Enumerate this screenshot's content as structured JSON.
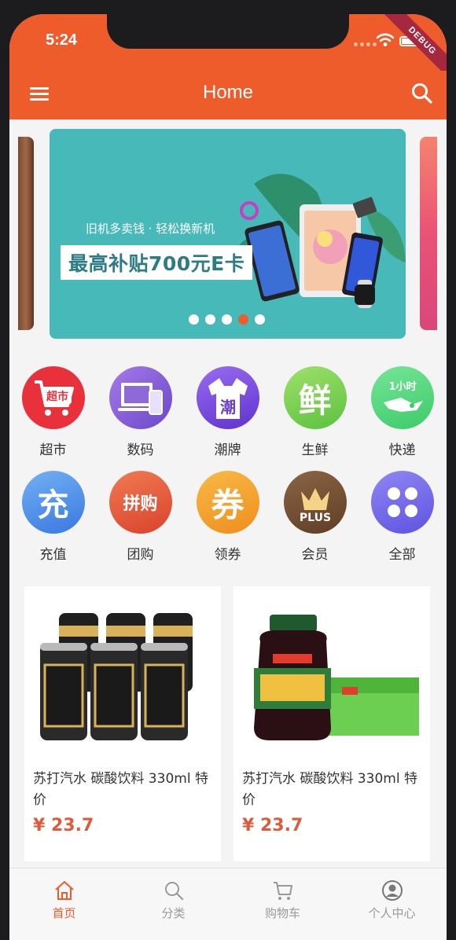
{
  "status_bar": {
    "time": "5:24",
    "debug_label": "DEBUG"
  },
  "app_bar": {
    "title": "Home",
    "menu_icon": "hamburger-menu-icon",
    "search_icon": "search-icon"
  },
  "banner": {
    "subtitle": "旧机多卖钱 · 轻松换新机",
    "headline": "最高补贴700元E卡",
    "page_count": 5,
    "active_index": 3
  },
  "categories": [
    {
      "label": "超市",
      "icon": "supermarket-cart-icon",
      "icon_text": "超市",
      "color": "#e8313b"
    },
    {
      "label": "数码",
      "icon": "digital-devices-icon",
      "icon_text": "",
      "color": "#8a62d6"
    },
    {
      "label": "潮牌",
      "icon": "trend-brand-shirt-icon",
      "icon_text": "潮",
      "color": "#7d4fe0"
    },
    {
      "label": "生鲜",
      "icon": "fresh-food-icon",
      "icon_text": "鲜",
      "color": "#7fd35a"
    },
    {
      "label": "快递",
      "icon": "express-delivery-icon",
      "icon_text": "1小时",
      "color": "#58d97c"
    },
    {
      "label": "充值",
      "icon": "recharge-icon",
      "icon_text": "充",
      "color": "#4a90e8"
    },
    {
      "label": "团购",
      "icon": "group-buy-icon",
      "icon_text": "拼购",
      "color": "#e8553a"
    },
    {
      "label": "领券",
      "icon": "coupon-icon",
      "icon_text": "券",
      "color": "#f4a12b"
    },
    {
      "label": "会员",
      "icon": "plus-member-crown-icon",
      "icon_text": "PLUS",
      "color": "#7a5236"
    },
    {
      "label": "全部",
      "icon": "all-categories-icon",
      "icon_text": "",
      "color": "#7a6ef0"
    }
  ],
  "products": [
    {
      "title": "苏打汽水 碳酸饮料 330ml 特价",
      "price": "¥ 23.7",
      "image": "soda-cans-image"
    },
    {
      "title": "苏打汽水 碳酸饮料 330ml 特价",
      "price": "¥ 23.7",
      "image": "plum-juice-bottle-image"
    }
  ],
  "bottom_nav": [
    {
      "label": "首页",
      "icon": "home-icon",
      "active": true
    },
    {
      "label": "分类",
      "icon": "search-icon",
      "active": false
    },
    {
      "label": "购物车",
      "icon": "shopping-cart-icon",
      "active": false
    },
    {
      "label": "个人中心",
      "icon": "user-profile-icon",
      "active": false
    }
  ],
  "colors": {
    "primary": "#ee5c2c",
    "price": "#e05a3a",
    "nav_inactive": "#999999"
  }
}
